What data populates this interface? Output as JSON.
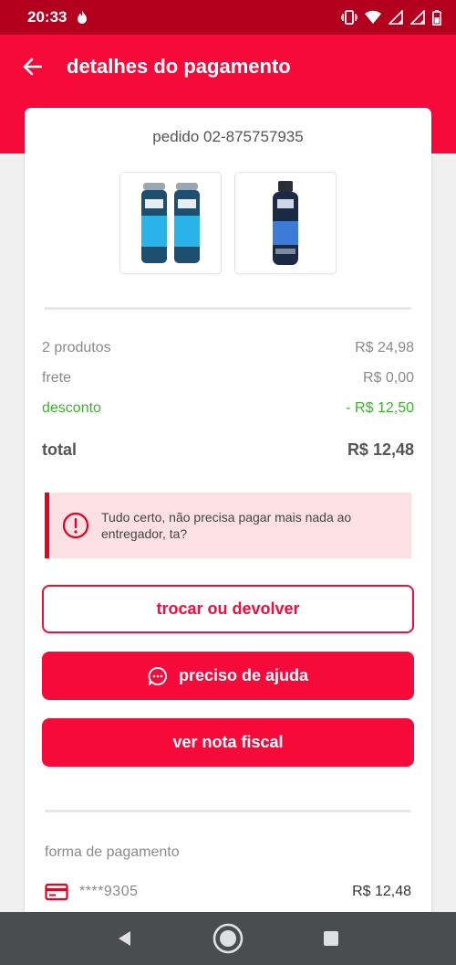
{
  "status_bar": {
    "time": "20:33"
  },
  "header": {
    "title": "detalhes do pagamento"
  },
  "order": {
    "id_label": "pedido 02-875757935",
    "products": [
      {
        "name": "rexona-spray-pack"
      },
      {
        "name": "one-spray"
      }
    ]
  },
  "summary": {
    "products_label": "2 produtos",
    "products_value": "R$ 24,98",
    "shipping_label": "frete",
    "shipping_value": "R$ 0,00",
    "discount_label": "desconto",
    "discount_value": "- R$ 12,50",
    "total_label": "total",
    "total_value": "R$ 12,48"
  },
  "notice": {
    "text": "Tudo certo, não precisa pagar mais nada ao entregador, ta?",
    "icon": "info-icon"
  },
  "actions": {
    "exchange_label": "trocar ou devolver",
    "help_label": "preciso de ajuda",
    "invoice_label": "ver nota fiscal"
  },
  "payment": {
    "label": "forma de pagamento",
    "card_number": "****9305",
    "amount": "R$ 12,48"
  },
  "colors": {
    "brand": "#f50a3a",
    "status_bar": "#b3001f",
    "discount": "#37b626",
    "notice_bg": "#fde0e4"
  }
}
